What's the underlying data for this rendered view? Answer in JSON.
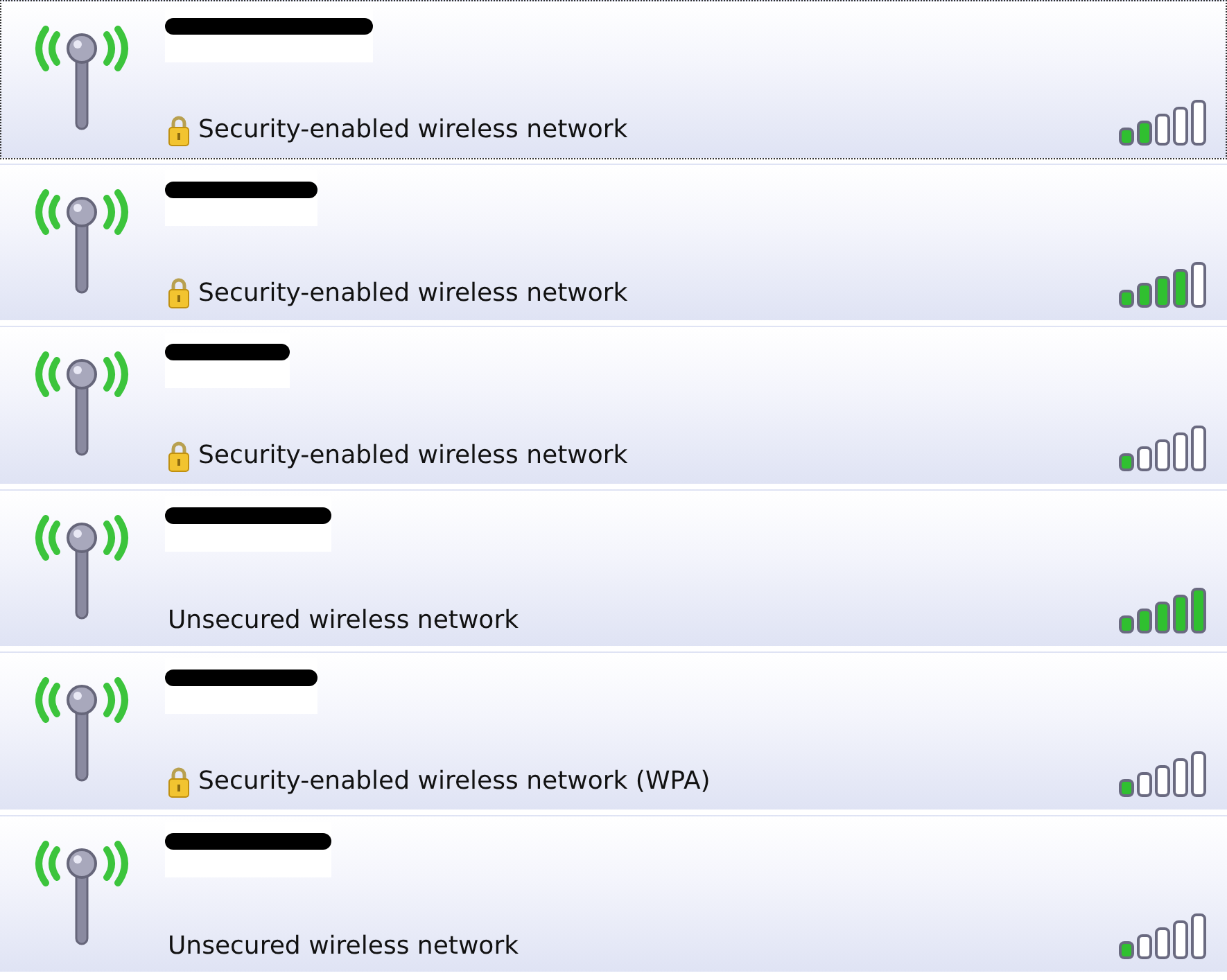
{
  "networks": [
    {
      "name_redacted": true,
      "secured": true,
      "status": "Security-enabled wireless network",
      "level": 0.4,
      "focused": true
    },
    {
      "name_redacted": true,
      "secured": true,
      "status": "Security-enabled wireless network",
      "level": 0.8,
      "focused": false
    },
    {
      "name_redacted": true,
      "secured": true,
      "status": "Security-enabled wireless network",
      "level": 0.2,
      "focused": false
    },
    {
      "name_redacted": true,
      "secured": false,
      "status": "Unsecured wireless network",
      "level": 1,
      "focused": false
    },
    {
      "name_redacted": true,
      "secured": true,
      "status": "Security-enabled wireless network (WPA)",
      "level": 0.2,
      "focused": false
    },
    {
      "name_redacted": true,
      "secured": false,
      "status": "Unsecured wireless network",
      "level": 0.2,
      "focused": false
    }
  ]
}
